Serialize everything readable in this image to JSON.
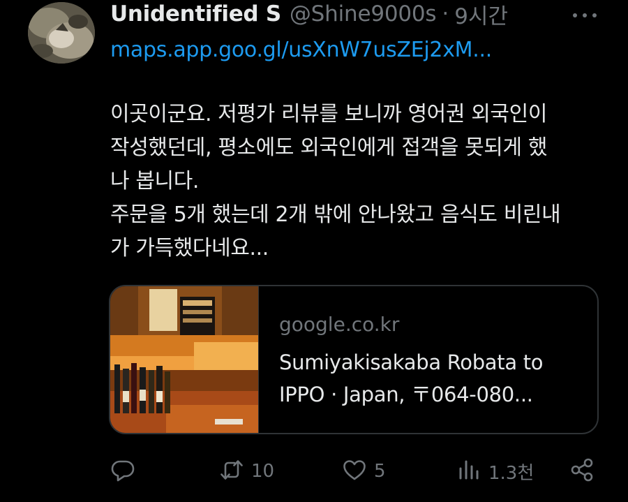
{
  "tweet": {
    "display_name": "Unidentified S",
    "handle": "@Shine9000s",
    "separator": "·",
    "time": "9시간",
    "link_text": "maps.app.goo.gl/usXnW7usZEj2xM...",
    "body_lines": [
      "이곳이군요. 저평가 리뷰를 보니까 영어권 외국인이",
      "작성했던데, 평소에도 외국인에게 접객을 못되게 했",
      "나 봅니다.",
      "주문을 5개 했는데 2개 밖에 안나왔고 음식도 비린내",
      "가 가득했다네요..."
    ]
  },
  "card": {
    "domain": "google.co.kr",
    "title_lines": [
      "Sumiyakisakaba Robata to",
      "IPPO · Japan, 〒064-080..."
    ]
  },
  "actions": {
    "reply_count": "",
    "retweet_count": "10",
    "like_count": "5",
    "views_count": "1.3천"
  },
  "icons": {
    "more": "more-horizontal-icon",
    "reply": "reply-bubble-icon",
    "retweet": "retweet-icon",
    "like": "heart-icon",
    "views": "bar-chart-icon",
    "share": "share-icon"
  },
  "colors": {
    "background": "#000000",
    "text": "#e7e9ea",
    "muted": "#71767b",
    "link": "#1d9bf0",
    "border": "#2f3336"
  }
}
